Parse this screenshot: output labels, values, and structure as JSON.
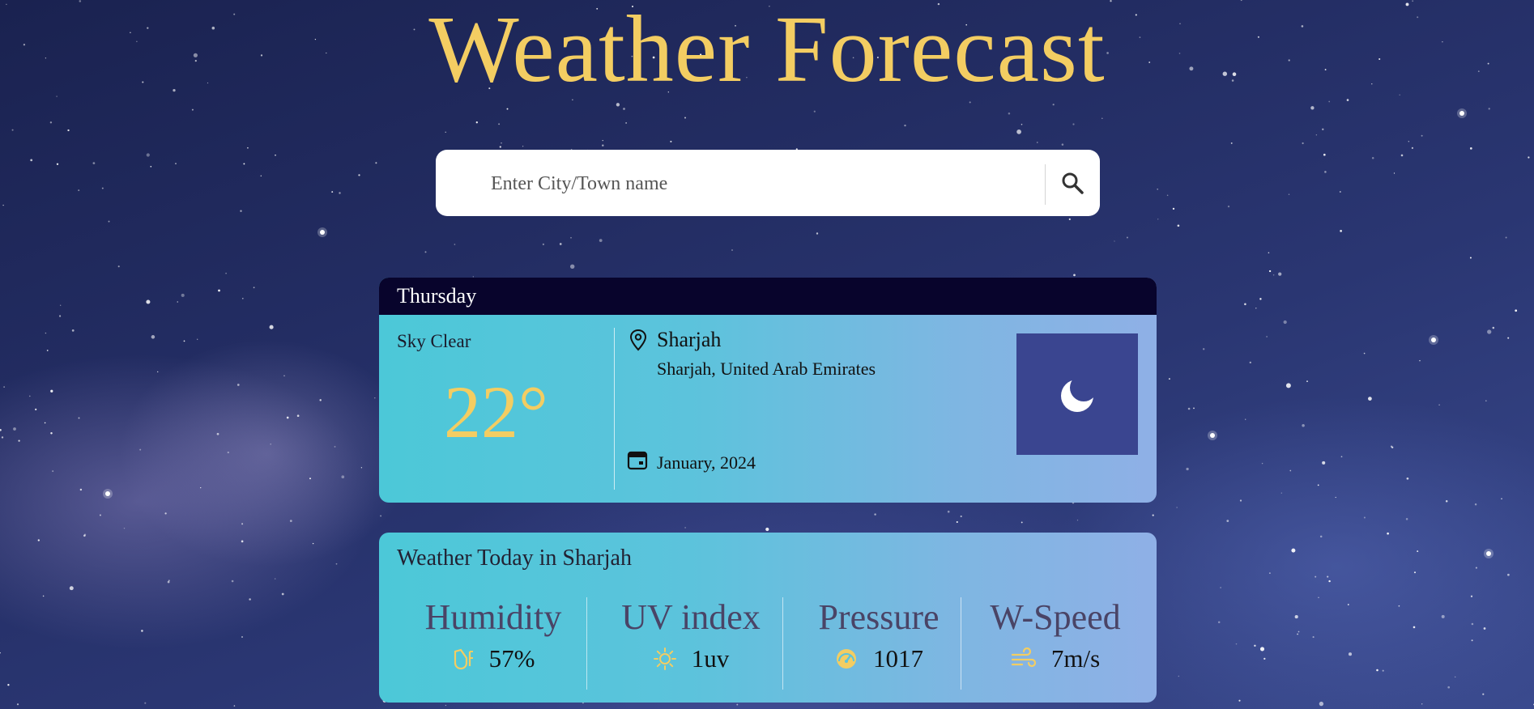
{
  "app": {
    "title": "Weather Forecast"
  },
  "search": {
    "placeholder": "Enter City/Town name",
    "icon": "search-icon"
  },
  "current": {
    "day": "Thursday",
    "condition": "Sky Clear",
    "temperature": "22°",
    "city": "Sharjah",
    "region": "Sharjah, United Arab Emirates",
    "date": "January, 2024",
    "weather_icon": "moon-icon"
  },
  "today": {
    "title": "Weather Today in Sharjah",
    "metrics": [
      {
        "label": "Humidity",
        "value": "57%",
        "icon": "humidity-icon"
      },
      {
        "label": "UV index",
        "value": "1uv",
        "icon": "sun-icon"
      },
      {
        "label": "Pressure",
        "value": "1017",
        "icon": "gauge-icon"
      },
      {
        "label": "W-Speed",
        "value": "7m/s",
        "icon": "wind-icon"
      }
    ]
  },
  "colors": {
    "accent": "#f3cd62",
    "header_bg": "#08042c",
    "moon_box": "#3a4590"
  }
}
